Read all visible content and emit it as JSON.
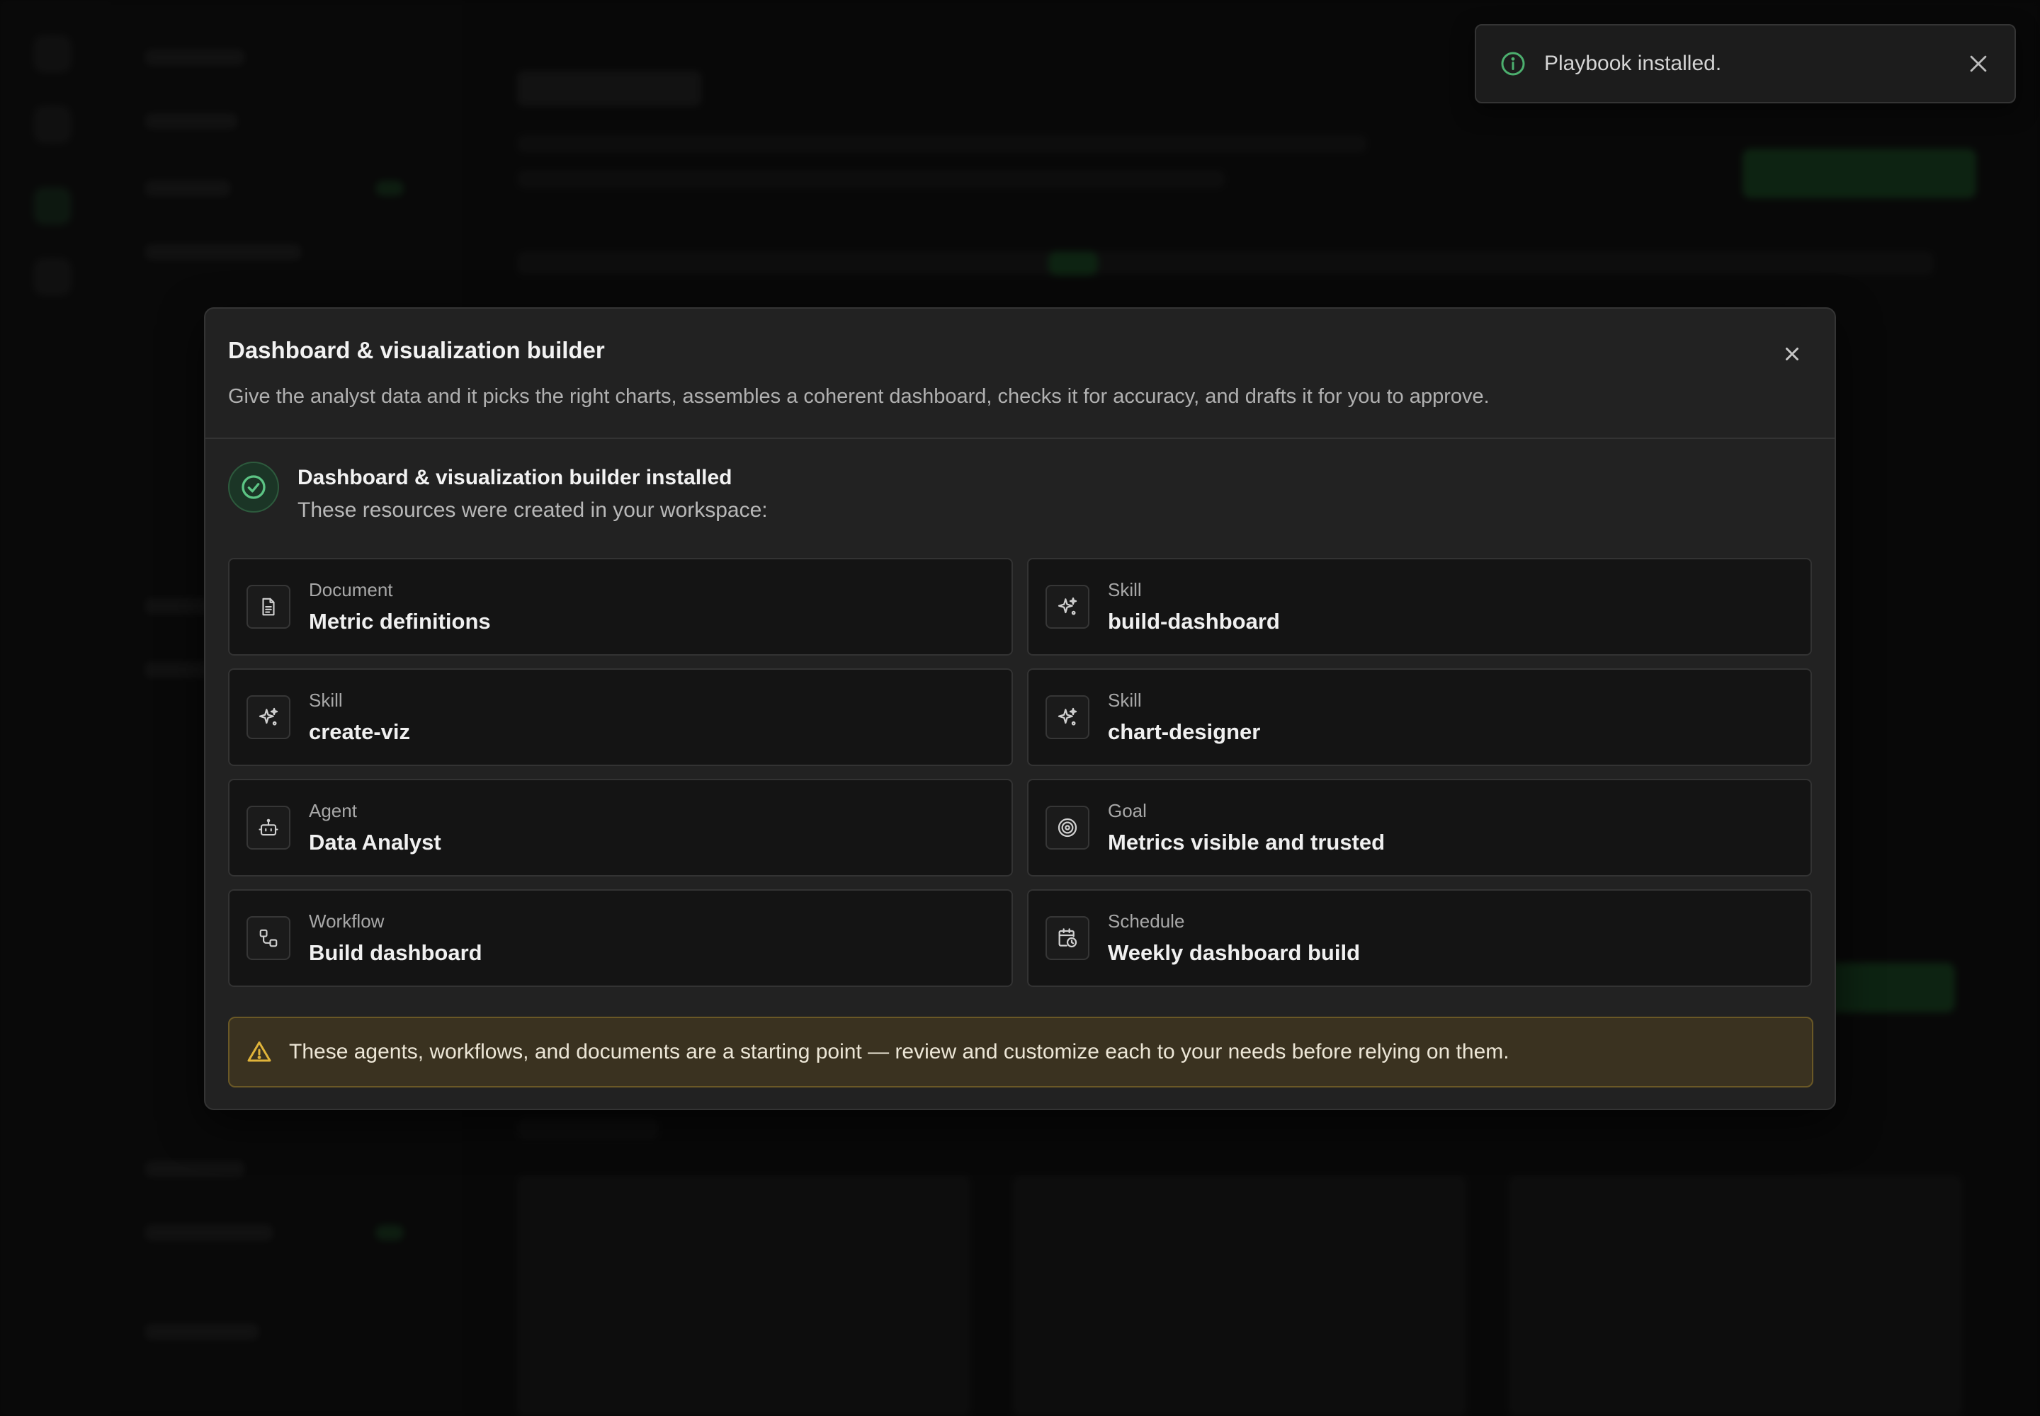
{
  "toast": {
    "message": "Playbook installed."
  },
  "modal": {
    "title": "Dashboard & visualization builder",
    "description": "Give the analyst data and it picks the right charts, assembles a coherent dashboard, checks it for accuracy, and drafts it for you to approve.",
    "success_title": "Dashboard & visualization builder installed",
    "success_subtitle": "These resources were created in your workspace:",
    "resources": [
      {
        "type": "Document",
        "name": "Metric definitions",
        "icon": "document-icon"
      },
      {
        "type": "Skill",
        "name": "build-dashboard",
        "icon": "sparkle-icon"
      },
      {
        "type": "Skill",
        "name": "create-viz",
        "icon": "sparkle-icon"
      },
      {
        "type": "Skill",
        "name": "chart-designer",
        "icon": "sparkle-icon"
      },
      {
        "type": "Agent",
        "name": "Data Analyst",
        "icon": "robot-icon"
      },
      {
        "type": "Goal",
        "name": "Metrics visible and trusted",
        "icon": "target-icon"
      },
      {
        "type": "Workflow",
        "name": "Build dashboard",
        "icon": "workflow-icon"
      },
      {
        "type": "Schedule",
        "name": "Weekly dashboard build",
        "icon": "calendar-clock-icon"
      }
    ],
    "warning": "These agents, workflows, and documents are a starting point — review and customize each to your needs before relying on them."
  },
  "colors": {
    "accent_green": "#4caf6e",
    "warning_yellow": "#e0b43a"
  }
}
